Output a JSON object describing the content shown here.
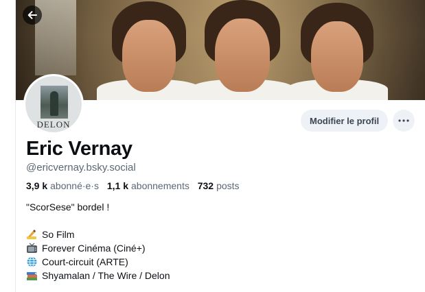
{
  "profile": {
    "display_name": "Eric Vernay",
    "handle": "@ericvernay.bsky.social",
    "avatar_text": "DELON",
    "stats": {
      "followers_count": "3,9 k",
      "followers_label": "abonné·e·s",
      "following_count": "1,1 k",
      "following_label": "abonnements",
      "posts_count": "732",
      "posts_label": "posts"
    },
    "bio": {
      "line1": "\"ScorSese\" bordel !",
      "items": [
        {
          "icon": "writing-hand-icon",
          "text": "So Film"
        },
        {
          "icon": "television-icon",
          "text": "Forever Cinéma (Ciné+)"
        },
        {
          "icon": "globe-icon",
          "text": "Court-circuit (ARTE)"
        },
        {
          "icon": "books-icon",
          "text": "Shyamalan / The Wire / Delon"
        }
      ]
    }
  },
  "actions": {
    "edit_profile_label": "Modifier le profil",
    "more_icon": "ellipsis-icon",
    "back_icon": "arrow-left-icon"
  },
  "colors": {
    "muted_text": "#5b6775",
    "button_bg": "#eef1f5",
    "text": "#0b0f14"
  }
}
